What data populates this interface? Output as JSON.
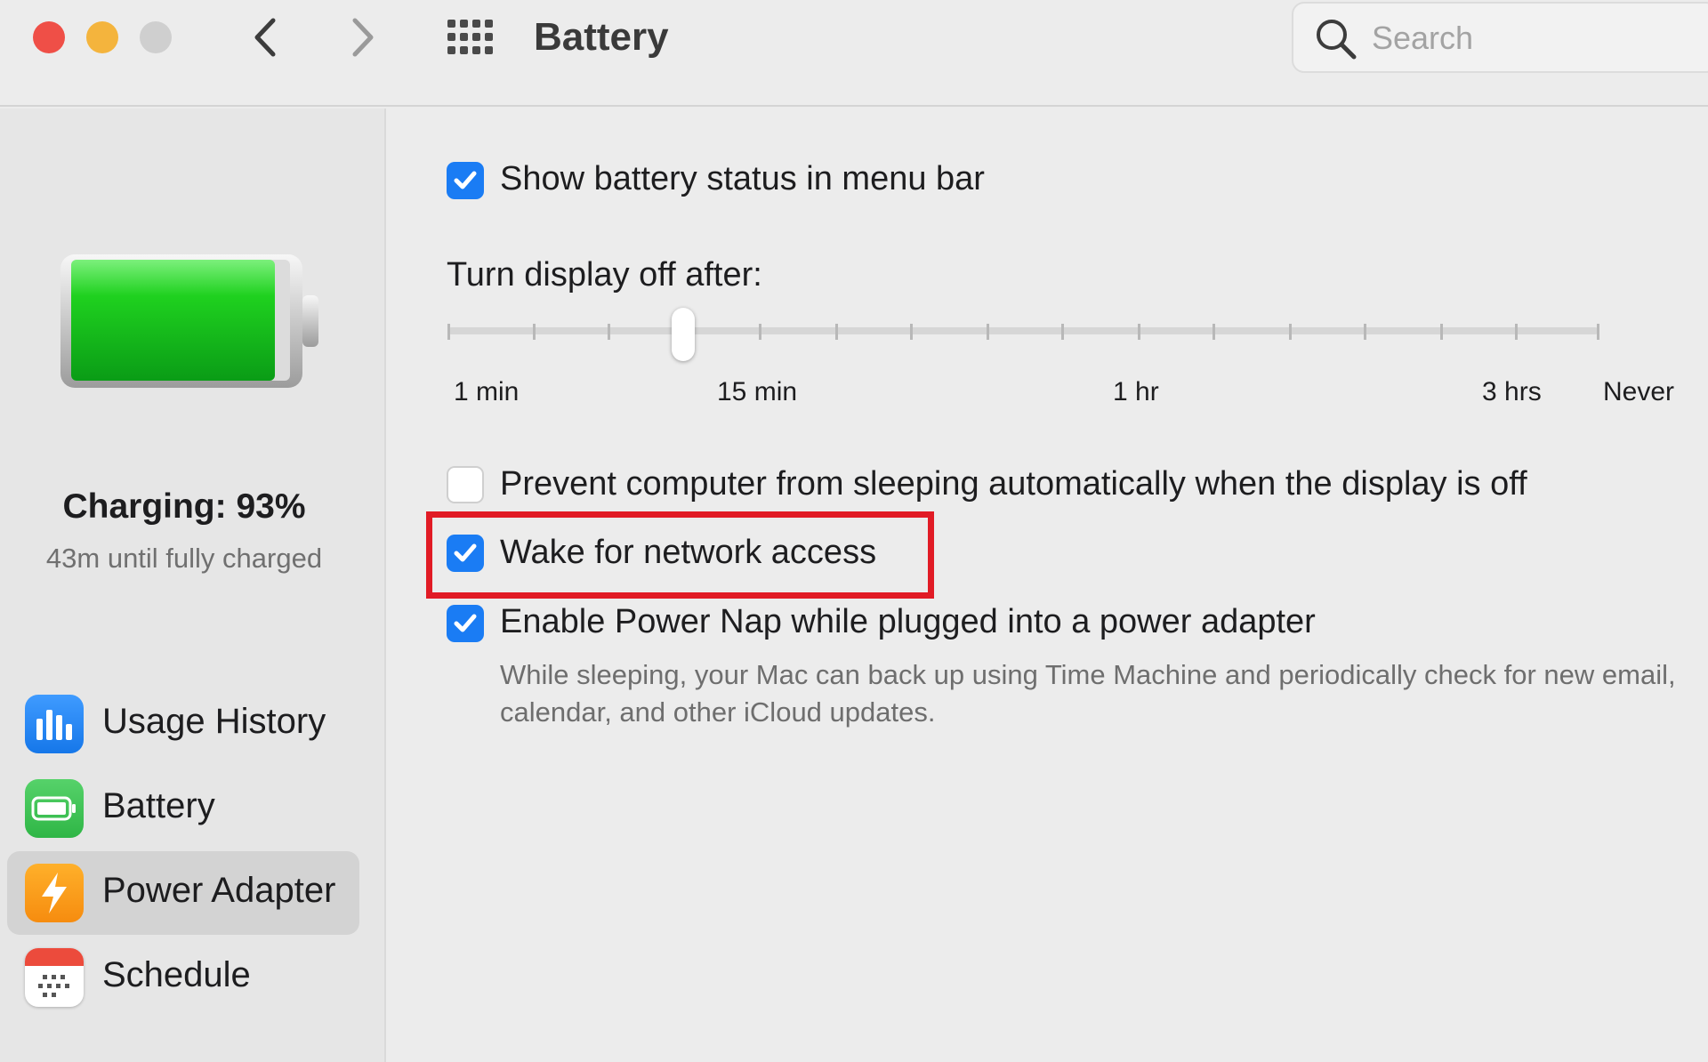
{
  "window": {
    "title": "Battery",
    "search_placeholder": "Search"
  },
  "sidebar": {
    "charge_status": "Charging: 93%",
    "charge_time": "43m until fully charged",
    "battery_level_percent": 93,
    "items": [
      {
        "label": "Usage History",
        "icon": "bar-chart-icon",
        "selected": false
      },
      {
        "label": "Battery",
        "icon": "battery-icon",
        "selected": false
      },
      {
        "label": "Power Adapter",
        "icon": "lightning-bolt-icon",
        "selected": true
      },
      {
        "label": "Schedule",
        "icon": "calendar-icon",
        "selected": false
      }
    ]
  },
  "main": {
    "show_status": {
      "label": "Show battery status in menu bar",
      "checked": true
    },
    "display_off": {
      "title": "Turn display off after:",
      "ticks": [
        "1 min",
        "15 min",
        "1 hr",
        "3 hrs",
        "Never"
      ],
      "selected_value": "10 min"
    },
    "prevent_sleep": {
      "label": "Prevent computer from sleeping automatically when the display is off",
      "checked": false
    },
    "wake_network": {
      "label": "Wake for network access",
      "checked": true
    },
    "power_nap": {
      "label": "Enable Power Nap while plugged into a power adapter",
      "checked": true,
      "description": "While sleeping, your Mac can back up using Time Machine and periodically check for new email, calendar, and other iCloud updates."
    }
  },
  "colors": {
    "accent": "#1a7cf4",
    "highlight": "#e11b25",
    "battery_green": "#2fd12f"
  }
}
